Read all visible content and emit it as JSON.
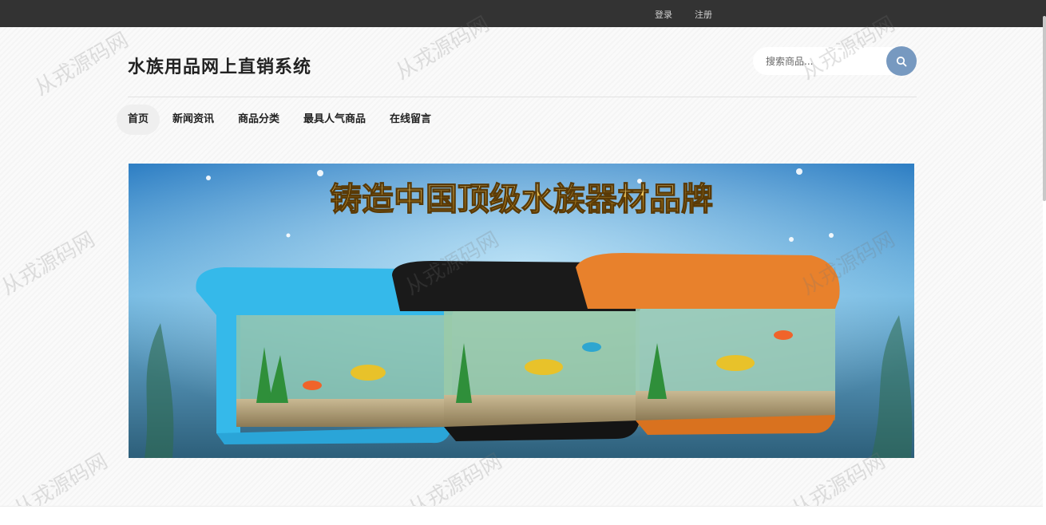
{
  "topbar": {
    "login": "登录",
    "register": "注册"
  },
  "header": {
    "site_title": "水族用品网上直销系统"
  },
  "search": {
    "placeholder": "搜索商品..."
  },
  "nav": {
    "items": [
      {
        "label": "首页",
        "active": true
      },
      {
        "label": "新闻资讯"
      },
      {
        "label": "商品分类"
      },
      {
        "label": "最具人气商品"
      },
      {
        "label": "在线留言"
      }
    ]
  },
  "banner": {
    "headline": "铸造中国顶级水族器材品牌",
    "tank_colors": [
      "#35b9ea",
      "#1a1a1a",
      "#e8812c"
    ]
  },
  "watermark": {
    "text": "从戎源码网"
  },
  "colors": {
    "topbar_bg": "#333333",
    "accent": "#7799c0"
  }
}
